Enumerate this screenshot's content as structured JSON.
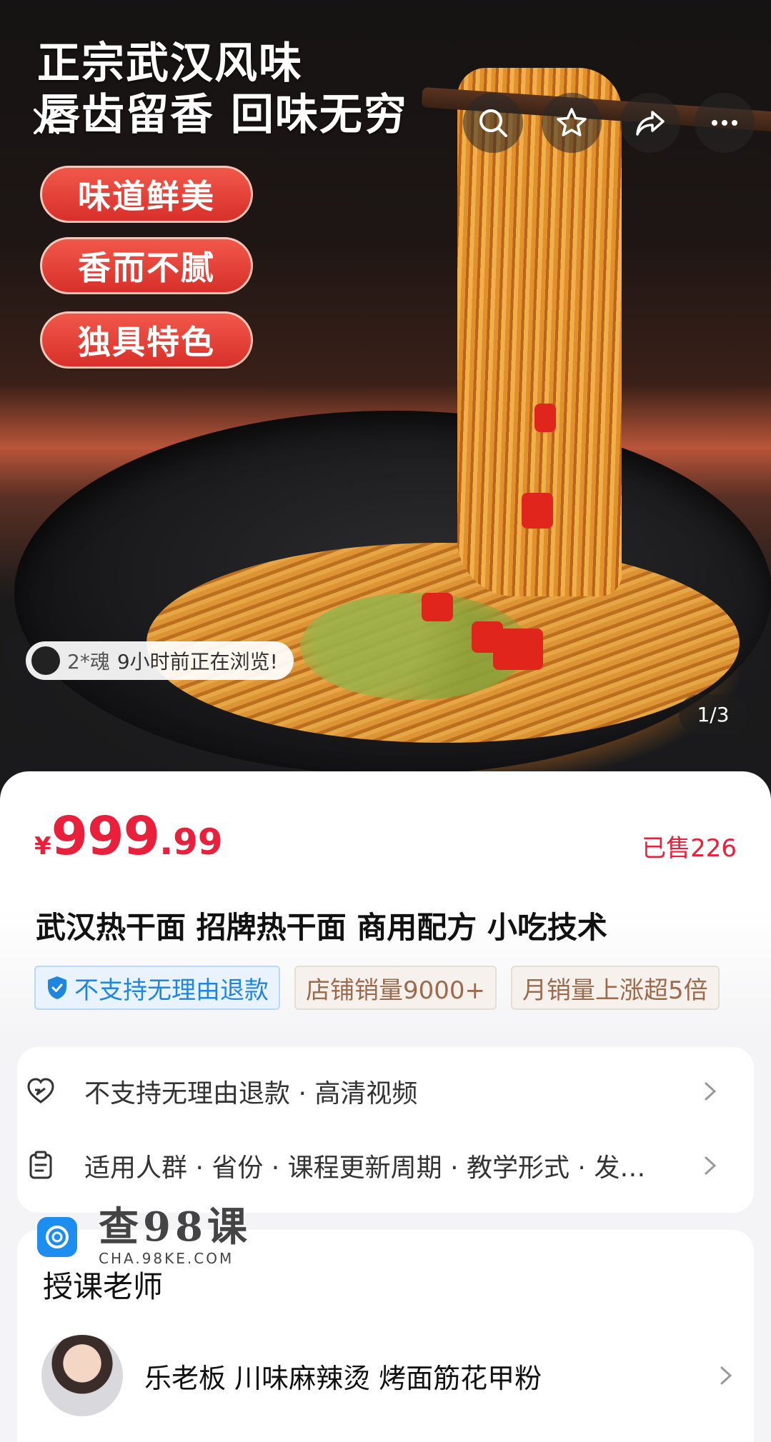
{
  "hero": {
    "title_line1": "正宗武汉风味",
    "title_line2": "唇齿留香 回味无穷",
    "pills": [
      "味道鲜美",
      "香而不腻",
      "独具特色"
    ],
    "viewer_name": "2*魂",
    "viewer_text": "9小时前正在浏览!",
    "page_indicator": "1/3"
  },
  "toolbar": {
    "close_icon": "close-icon",
    "search_icon": "search-icon",
    "favorite_icon": "star-icon",
    "share_icon": "share-icon",
    "more_icon": "more-icon"
  },
  "product": {
    "currency": "¥",
    "price_int": "999",
    "price_dec": ".99",
    "sold": "已售226",
    "title": "武汉热干面 招牌热干面 商用配方 小吃技术",
    "tags": [
      "不支持无理由退款",
      "店铺销量9000+",
      "月销量上涨超5倍"
    ]
  },
  "info": {
    "row1": "不支持无理由退款 · 高清视频",
    "row2": "适用人群 · 省份 · 课程更新周期 · 教学形式 · 发…"
  },
  "teacher": {
    "heading": "授课老师",
    "name": "乐老板 川味麻辣烫 烤面筋花甲粉"
  },
  "watermark": {
    "title": "查98课",
    "subtitle": "CHA.98KE.COM"
  },
  "colors": {
    "accent": "#e8203c",
    "blue_tag": "#1f86e0",
    "beige_tag": "#9c6a4c"
  }
}
